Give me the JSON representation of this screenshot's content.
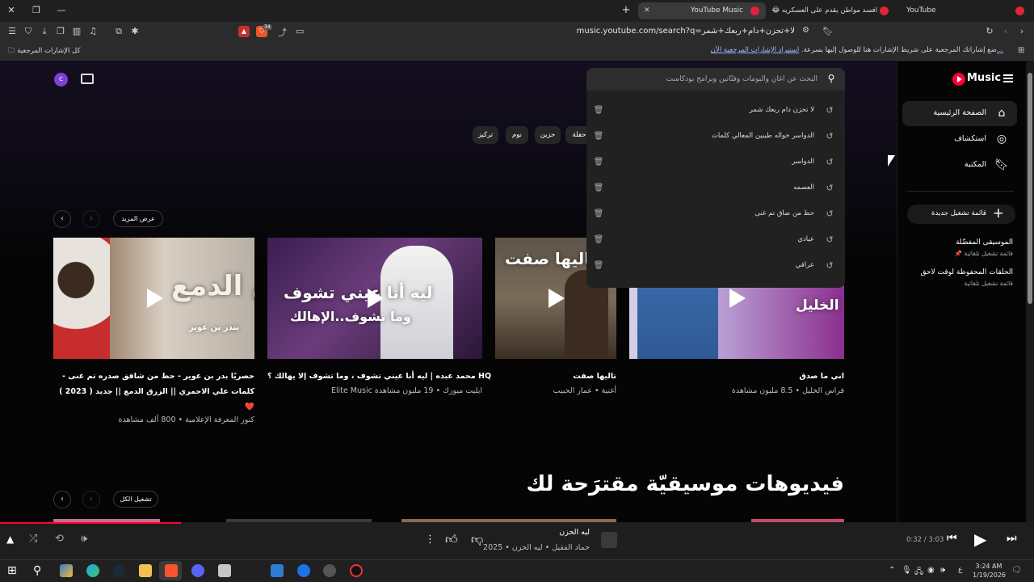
{
  "browser": {
    "tabs": [
      {
        "title": "YouTube",
        "active": false
      },
      {
        "title": "😂 افسد مواطن يقدم على العسكريه",
        "active": false
      },
      {
        "title": "YouTube Music",
        "active": true
      }
    ],
    "new_tab": "+",
    "address": "music.youtube.com/search?q=لا+تحزن+دام+ربعك+شمر",
    "shield_count": "34",
    "bookmarks_hint": "ضع إشاراتك المرجعية على شريط الإشارات هنا للوصول إليها بسرعة.",
    "bookmarks_link": "استيراد الإشارات المرجعية الآن...",
    "all_bookmarks": "كل الإشارات المرجعية"
  },
  "app": {
    "logo": "Music",
    "avatar_letter": "c",
    "search": {
      "placeholder": "البحث عن أغانٍ وألبومات وفنّانين وبرامج بودكاست",
      "suggestions": [
        "لا تحزن دام ربعك شمر",
        "الدواسر خواله طيبين المعالي كلمات",
        "الدواسر",
        "العصمه",
        "حظ من ضاق تم غنى",
        "عيادي",
        "عراقي"
      ]
    },
    "chips": [
      "حفلة",
      "حزين",
      "نوم",
      "تركيز"
    ],
    "sidebar": {
      "items": [
        {
          "label": "الصفحة الرئيسية",
          "icon": "home-icon"
        },
        {
          "label": "استكشاف",
          "icon": "compass-icon"
        },
        {
          "label": "المكتبة",
          "icon": "library-icon"
        }
      ],
      "new_playlist": "قائمة تشغيل جديدة",
      "playlists": [
        {
          "title": "الموسيقى المفضّلة",
          "subtitle": "📌 قائمة تشغيل تلقائية"
        },
        {
          "title": "الحلقات المحفوظة لوقت لاحق",
          "subtitle": "قائمة تشغيل تلقائية"
        }
      ]
    },
    "more_button": "عرض المزيد",
    "play_all_button": "تشغيل الكل",
    "section_title": "فيديوهات موسيقيّة مقترَحة لك",
    "cards": [
      {
        "title": "حصريًا بدر بن عوير - حظ من شاقق صدره تم غنى - كلمات علي الاحمري || الزرق الدمع || جديد ( 2023 ) ❤️",
        "subtitle": "كنوز المعرفة الإعلامية • 800 ألف مشاهدة",
        "overlay": "ق الدمع",
        "overlay2": "بندر بن عوير"
      },
      {
        "title": "محمد عبده | ليه أنا عيني تشوف ، وما تشوف إلا يهالك ؟ HQ",
        "subtitle": "Elite Music ايليت ميوزك • 19 مليون مشاهدة",
        "overlay": "ليه أنا عيني تشوف",
        "overlay2": "وما تشوف..الإهالك"
      },
      {
        "title": "تاليها صفت",
        "subtitle": "أغنية • عمار الحبيب",
        "overlay": "تاليها صفت",
        "overlay2": ""
      },
      {
        "title": "اني ما صدق",
        "subtitle": "فراس الخليل • 8.5 مليون مشاهدة",
        "overlay": "الخليل",
        "overlay2": ""
      }
    ]
  },
  "player": {
    "title": "ليه الحزن",
    "subtitle": "حماد الفقيل • ليه الحزن • 2025",
    "time": "0:32 / 3:03",
    "progress": 0.175
  },
  "taskbar": {
    "time": "3:24 AM",
    "date": "1/19/2026"
  },
  "colors": {
    "brand": "#ff0033",
    "avatar": "#7e3fd6",
    "page_bg": "#050505"
  }
}
